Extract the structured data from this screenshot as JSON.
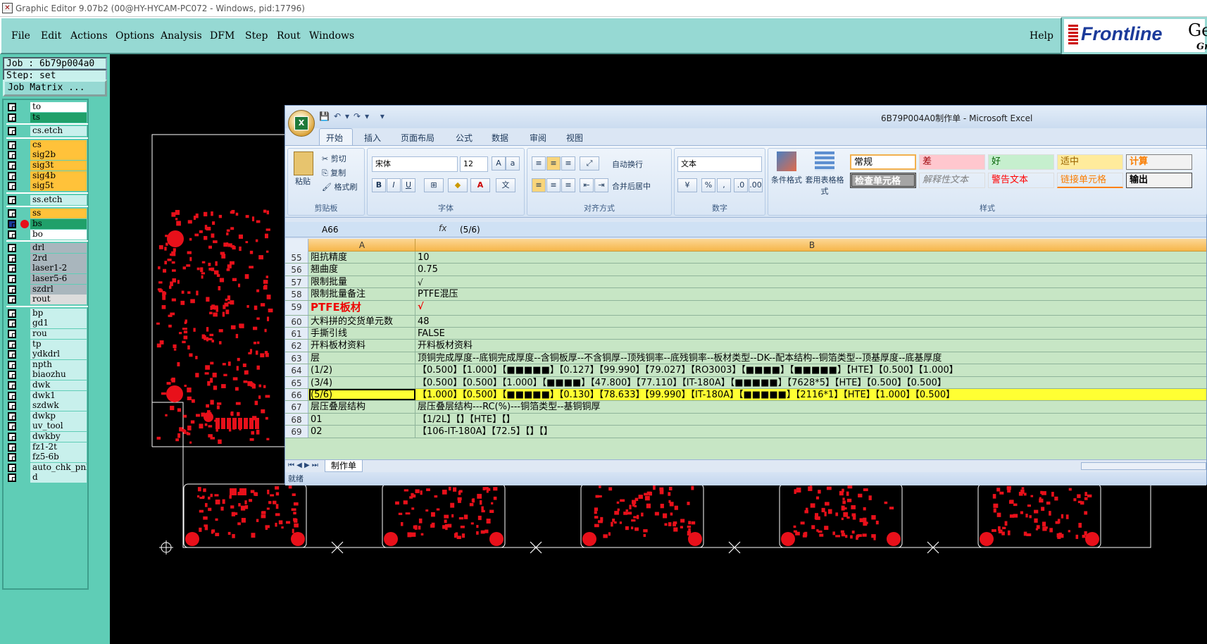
{
  "window": {
    "title": "Graphic Editor 9.07b2 (00@HY-HYCAM-PC072 - Windows, pid:17796)"
  },
  "menu": [
    "File",
    "Edit",
    "Actions",
    "Options",
    "Analysis",
    "DFM",
    "Step",
    "Rout",
    "Windows"
  ],
  "help": "Help",
  "logo": {
    "brand": "Frontline",
    "suffix": "Ger",
    "sub": "Gr"
  },
  "job": {
    "label": "Job : 6b79p004a0",
    "step": "Step: set",
    "matrix_button": "Job Matrix ..."
  },
  "layers": [
    {
      "name": "to",
      "color": "#ffffff",
      "group": 1
    },
    {
      "name": "ts",
      "color": "#20a06a",
      "group": 1
    },
    {
      "name": "cs.etch",
      "color": "#c8f0ec",
      "group": 2
    },
    {
      "name": "cs",
      "color": "#ffc23a",
      "group": 3
    },
    {
      "name": "sig2b",
      "color": "#ffc23a",
      "group": 3
    },
    {
      "name": "sig3t",
      "color": "#ffc23a",
      "group": 3
    },
    {
      "name": "sig4b",
      "color": "#ffc23a",
      "group": 3
    },
    {
      "name": "sig5t",
      "color": "#ffc23a",
      "group": 3
    },
    {
      "name": "ss.etch",
      "color": "#c8f0ec",
      "group": 4
    },
    {
      "name": "ss",
      "color": "#ffc23a",
      "group": 5
    },
    {
      "name": "bs",
      "color": "#20a06a",
      "group": 5,
      "active": true
    },
    {
      "name": "bo",
      "color": "#ffffff",
      "group": 5
    },
    {
      "name": "drl",
      "color": "#a9b6bd",
      "group": 6
    },
    {
      "name": "2rd",
      "color": "#a9b6bd",
      "group": 6
    },
    {
      "name": "laser1-2",
      "color": "#a9b6bd",
      "group": 6
    },
    {
      "name": "laser5-6",
      "color": "#a9b6bd",
      "group": 6
    },
    {
      "name": "szdrl",
      "color": "#a9b6bd",
      "group": 6
    },
    {
      "name": "rout",
      "color": "#dcdcdc",
      "group": 6
    },
    {
      "name": "bp",
      "color": "#c8f0ec",
      "group": 7
    },
    {
      "name": "gd1",
      "color": "#c8f0ec",
      "group": 7
    },
    {
      "name": "rou",
      "color": "#c8f0ec",
      "group": 7
    },
    {
      "name": "tp",
      "color": "#c8f0ec",
      "group": 7
    },
    {
      "name": "ydkdrl",
      "color": "#c8f0ec",
      "group": 7
    },
    {
      "name": "npth",
      "color": "#c8f0ec",
      "group": 7
    },
    {
      "name": "biaozhu",
      "color": "#c8f0ec",
      "group": 7
    },
    {
      "name": "dwk",
      "color": "#c8f0ec",
      "group": 7
    },
    {
      "name": "dwk1",
      "color": "#c8f0ec",
      "group": 7
    },
    {
      "name": "szdwk",
      "color": "#c8f0ec",
      "group": 7
    },
    {
      "name": "dwkp",
      "color": "#c8f0ec",
      "group": 7
    },
    {
      "name": "uv_tool",
      "color": "#c8f0ec",
      "group": 7
    },
    {
      "name": "dwkby",
      "color": "#c8f0ec",
      "group": 7
    },
    {
      "name": "fz1-2t",
      "color": "#c8f0ec",
      "group": 7
    },
    {
      "name": "fz5-6b",
      "color": "#c8f0ec",
      "group": 7
    },
    {
      "name": "auto_chk_pnl",
      "color": "#c8f0ec",
      "group": 7
    },
    {
      "name": "d",
      "color": "#c8f0ec",
      "group": 7
    }
  ],
  "excel": {
    "title": "6B79P004A0制作单 - Microsoft Excel",
    "tabs": [
      "开始",
      "插入",
      "页面布局",
      "公式",
      "数据",
      "审阅",
      "视图"
    ],
    "clipboard": {
      "paste": "粘贴",
      "cut": "剪切",
      "copy": "复制",
      "format_painter": "格式刷",
      "label": "剪贴板"
    },
    "font": {
      "name": "宋体",
      "size": "12",
      "label": "字体",
      "bold": "B",
      "italic": "I",
      "underline": "U"
    },
    "alignment": {
      "wrap": "自动换行",
      "merge": "合并后居中",
      "label": "对齐方式"
    },
    "number": {
      "format": "文本",
      "percent": "%",
      "comma": ",",
      "label": "数字"
    },
    "styles_group": {
      "cond": "条件格式",
      "table": "套用表格格式",
      "label": "样式"
    },
    "styles": [
      "常规",
      "差",
      "好",
      "适中",
      "计算",
      "检查单元格",
      "解释性文本",
      "警告文本",
      "链接单元格",
      "输出"
    ],
    "name_box": "A66",
    "fx": "fx",
    "formula": "(5/6)",
    "col_a": "A",
    "col_b": "B",
    "rows": [
      {
        "n": "55",
        "a": "阻抗精度",
        "b": "10"
      },
      {
        "n": "56",
        "a": "翘曲度",
        "b": "0.75"
      },
      {
        "n": "57",
        "a": "限制批量",
        "b": "√"
      },
      {
        "n": "58",
        "a": "限制批量备注",
        "b": "PTFE混压"
      },
      {
        "n": "59",
        "a": "PTFE板材",
        "b": "√"
      },
      {
        "n": "60",
        "a": "大料拼的交货单元数",
        "b": "48"
      },
      {
        "n": "61",
        "a": "手撕引线",
        "b": "FALSE"
      },
      {
        "n": "62",
        "a": "开料板材资料",
        "b": "开料板材资料"
      },
      {
        "n": "63",
        "a": "层",
        "b": "顶铜完成厚度--底铜完成厚度--含铜板厚--不含铜厚--顶残铜率--底残铜率--板材类型--DK--配本结构--铜箔类型--顶基厚度--底基厚度"
      },
      {
        "n": "64",
        "a": "(1/2)",
        "b": "【0.500】【1.000】【■■■■■】【0.127】【99.990】【79.027】【RO3003】【■■■■】【■■■■■】【HTE】【0.500】【1.000】"
      },
      {
        "n": "65",
        "a": "(3/4)",
        "b": "【0.500】【0.500】【1.000】【■■■■】【47.800】【77.110】【IT-180A】【■■■■■】【7628*5】【HTE】【0.500】【0.500】"
      },
      {
        "n": "66",
        "a": "(5/6)",
        "b": "【1.000】【0.500】【■■■■■】【0.130】【78.633】【99.990】【IT-180A】【■■■■■】【2116*1】【HTE】【1.000】【0.500】"
      },
      {
        "n": "67",
        "a": "层压叠层结构",
        "b": "层压叠层结构---RC(%)---铜箔类型--基铜铜厚"
      },
      {
        "n": "68",
        "a": "01",
        "b": "【1/2L】【】【HTE】【】"
      },
      {
        "n": "69",
        "a": "02",
        "b": "【106-IT-180A】【72.5】【】【】"
      }
    ],
    "sheet": "制作单",
    "status": "就绪"
  },
  "colors": {
    "accent": "#96d9d3",
    "panel": "#5fcdb6",
    "pcb_red": "#e8101a",
    "highlight": "#ffff33"
  }
}
